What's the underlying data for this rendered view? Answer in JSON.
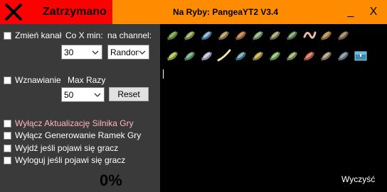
{
  "titlebar": {
    "status": "Zatrzymano",
    "app_title": "Na Ryby: PangeaYT2 V3.4",
    "minimize": "_",
    "close": "X",
    "status_color": "#ff0000",
    "bar_color": "#ff8c00"
  },
  "settings": {
    "change_channel_label": "Zmień kanał",
    "every_x_min_label": "Co X min:",
    "on_channel_label": "na channel:",
    "minutes_value": "30",
    "channel_value": "Random",
    "resume_label": "Wznawianie",
    "max_times_label": "Max Razy",
    "max_times_value": "50",
    "reset_label": "Reset"
  },
  "options": [
    {
      "label": "Wyłącz Aktualizację Silnika Gry"
    },
    {
      "label": "Wyłącz Generowanie Ramek Gry"
    },
    {
      "label": "Wyjdź jeśli pojawi się gracz"
    },
    {
      "label": "Wyloguj jeśli pojawi się gracz"
    }
  ],
  "progress": {
    "percent_text": "0%",
    "percent": 0
  },
  "inventory": {
    "clear_label": "Wyczyść",
    "row1": [
      "fish-green-icon",
      "fish-bass-icon",
      "fish-mackerel-icon",
      "fish-carp-icon",
      "fish-salmon-icon",
      "fish-trout-icon",
      "fish-bream-icon",
      "fish-pike-icon",
      "worm-bait-icon",
      "fish-perch-icon",
      "fish-catfish-icon"
    ],
    "row2": [
      "fish-yellow-icon",
      "fish-tench-icon",
      "fish-silver-icon",
      "eel-icon",
      "fish-tuna-icon",
      "fish-goldfish-icon",
      "fish-char-icon",
      "fish-goby-icon",
      "fish-red-icon",
      "fish-koi-icon",
      "fish-grayling-icon",
      "treasure-chest-icon"
    ]
  }
}
